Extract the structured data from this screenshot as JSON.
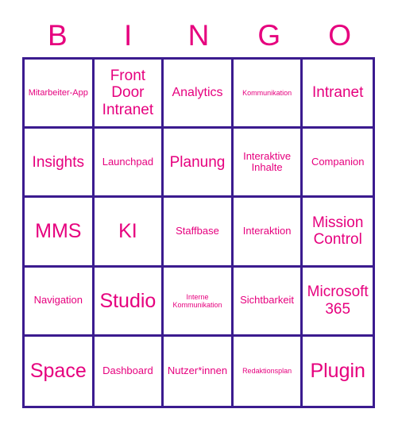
{
  "header": {
    "letters": [
      "B",
      "I",
      "N",
      "G",
      "O"
    ]
  },
  "colors": {
    "text": "#e6007e",
    "grid_border": "#3b1b8f",
    "background": "#ffffff"
  },
  "grid": {
    "columns": 5,
    "rows": 5,
    "cells": [
      {
        "label": "Mitarbeiter-App",
        "size": "s"
      },
      {
        "label": "Front Door Intranet",
        "size": "xl"
      },
      {
        "label": "Analytics",
        "size": "l"
      },
      {
        "label": "Kommunikation",
        "size": "xs"
      },
      {
        "label": "Intranet",
        "size": "xl"
      },
      {
        "label": "Insights",
        "size": "xl"
      },
      {
        "label": "Launchpad",
        "size": "m"
      },
      {
        "label": "Planung",
        "size": "xl"
      },
      {
        "label": "Interaktive Inhalte",
        "size": "m"
      },
      {
        "label": "Companion",
        "size": "m"
      },
      {
        "label": "MMS",
        "size": "xxl"
      },
      {
        "label": "KI",
        "size": "xxl"
      },
      {
        "label": "Staffbase",
        "size": "m"
      },
      {
        "label": "Interaktion",
        "size": "m"
      },
      {
        "label": "Mission Control",
        "size": "xl"
      },
      {
        "label": "Navigation",
        "size": "m"
      },
      {
        "label": "Studio",
        "size": "xxl"
      },
      {
        "label": "Interne Kommunikation",
        "size": "xs"
      },
      {
        "label": "Sichtbarkeit",
        "size": "m"
      },
      {
        "label": "Microsoft 365",
        "size": "xl"
      },
      {
        "label": "Space",
        "size": "xxl"
      },
      {
        "label": "Dashboard",
        "size": "m"
      },
      {
        "label": "Nutzer*innen",
        "size": "m"
      },
      {
        "label": "Redaktionsplan",
        "size": "xs"
      },
      {
        "label": "Plugin",
        "size": "xxl"
      }
    ]
  }
}
